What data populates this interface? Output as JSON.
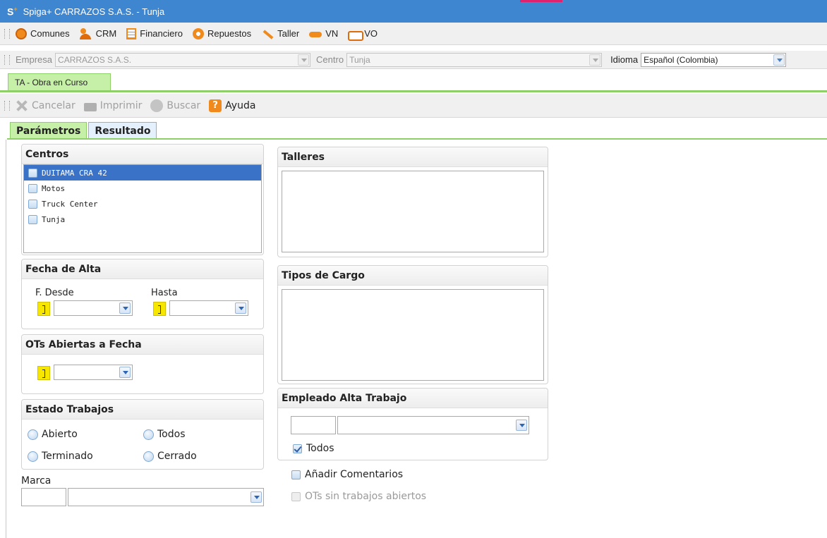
{
  "window": {
    "logo": "S",
    "title": "Spiga+ CARRAZOS S.A.S. - Tunja"
  },
  "menu": {
    "items": [
      {
        "label": "Comunes",
        "icon": "globe-icon"
      },
      {
        "label": "CRM",
        "icon": "users-icon"
      },
      {
        "label": "Financiero",
        "icon": "calculator-icon"
      },
      {
        "label": "Repuestos",
        "icon": "gear-icon"
      },
      {
        "label": "Taller",
        "icon": "wrench-icon"
      },
      {
        "label": "VN",
        "icon": "car-icon"
      },
      {
        "label": "VO",
        "icon": "used-car-icon"
      }
    ]
  },
  "company_bar": {
    "empresa_label": "Empresa",
    "empresa_value": "CARRAZOS S.A.S.",
    "centro_label": "Centro",
    "centro_value": "Tunja",
    "idioma_label": "Idioma",
    "idioma_value": "Español (Colombia)"
  },
  "doc_tab": {
    "label": "TA - Obra en Curso"
  },
  "toolbar": {
    "cancelar": "Cancelar",
    "imprimir": "Imprimir",
    "buscar": "Buscar",
    "ayuda": "Ayuda"
  },
  "subtabs": {
    "parametros": "Parámetros",
    "resultado": "Resultado"
  },
  "centros": {
    "title": "Centros",
    "items": [
      "DUITAMA CRA 42",
      "Motos",
      "Truck Center",
      "Tunja"
    ]
  },
  "fecha_alta": {
    "title": "Fecha de Alta",
    "desde_label": "F. Desde",
    "hasta_label": "Hasta"
  },
  "ots_abiertas": {
    "title": "OTs Abiertas a Fecha"
  },
  "estado_trabajos": {
    "title": "Estado Trabajos",
    "abierto": "Abierto",
    "todos": "Todos",
    "terminado": "Terminado",
    "cerrado": "Cerrado"
  },
  "marca": {
    "label": "Marca"
  },
  "talleres": {
    "title": "Talleres"
  },
  "tipos_cargo": {
    "title": "Tipos de Cargo"
  },
  "empleado": {
    "title": "Empleado Alta Trabajo",
    "todos_label": "Todos",
    "todos_checked": true
  },
  "options": {
    "comentarios": "Añadir Comentarios",
    "sin_trabajos": "OTs sin trabajos abiertos"
  },
  "colors": {
    "titlebar": "#3e86cf",
    "selection": "#3972c7",
    "active_tab": "#c6f0a8",
    "accent_orange": "#f08a1c"
  }
}
